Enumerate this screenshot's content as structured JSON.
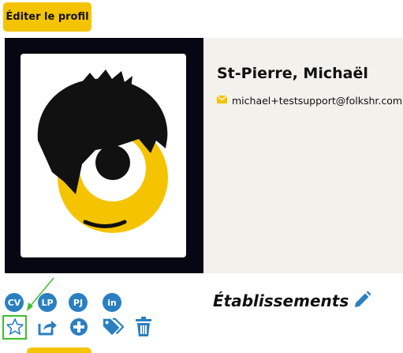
{
  "toolbar": {
    "edit_profile_label": "Éditer le profil"
  },
  "profile": {
    "name": "St-Pierre, Michaël",
    "email": "michael+testsupport@folkshr.com"
  },
  "documents": [
    {
      "id": "cv",
      "label": "CV"
    },
    {
      "id": "lp",
      "label": "LP"
    },
    {
      "id": "pj",
      "label": "PJ"
    },
    {
      "id": "linkedin",
      "label": "in"
    }
  ],
  "actions": [
    "star-icon",
    "share-icon",
    "add-icon",
    "tags-icon",
    "trash-icon"
  ],
  "section": {
    "title": "Établissements"
  },
  "colors": {
    "accent": "#f5c400",
    "icon_blue": "#2b7fc1",
    "highlight_green": "#3fbf2e",
    "photo_frame": "#060713",
    "card_background": "#f2f1ec"
  }
}
